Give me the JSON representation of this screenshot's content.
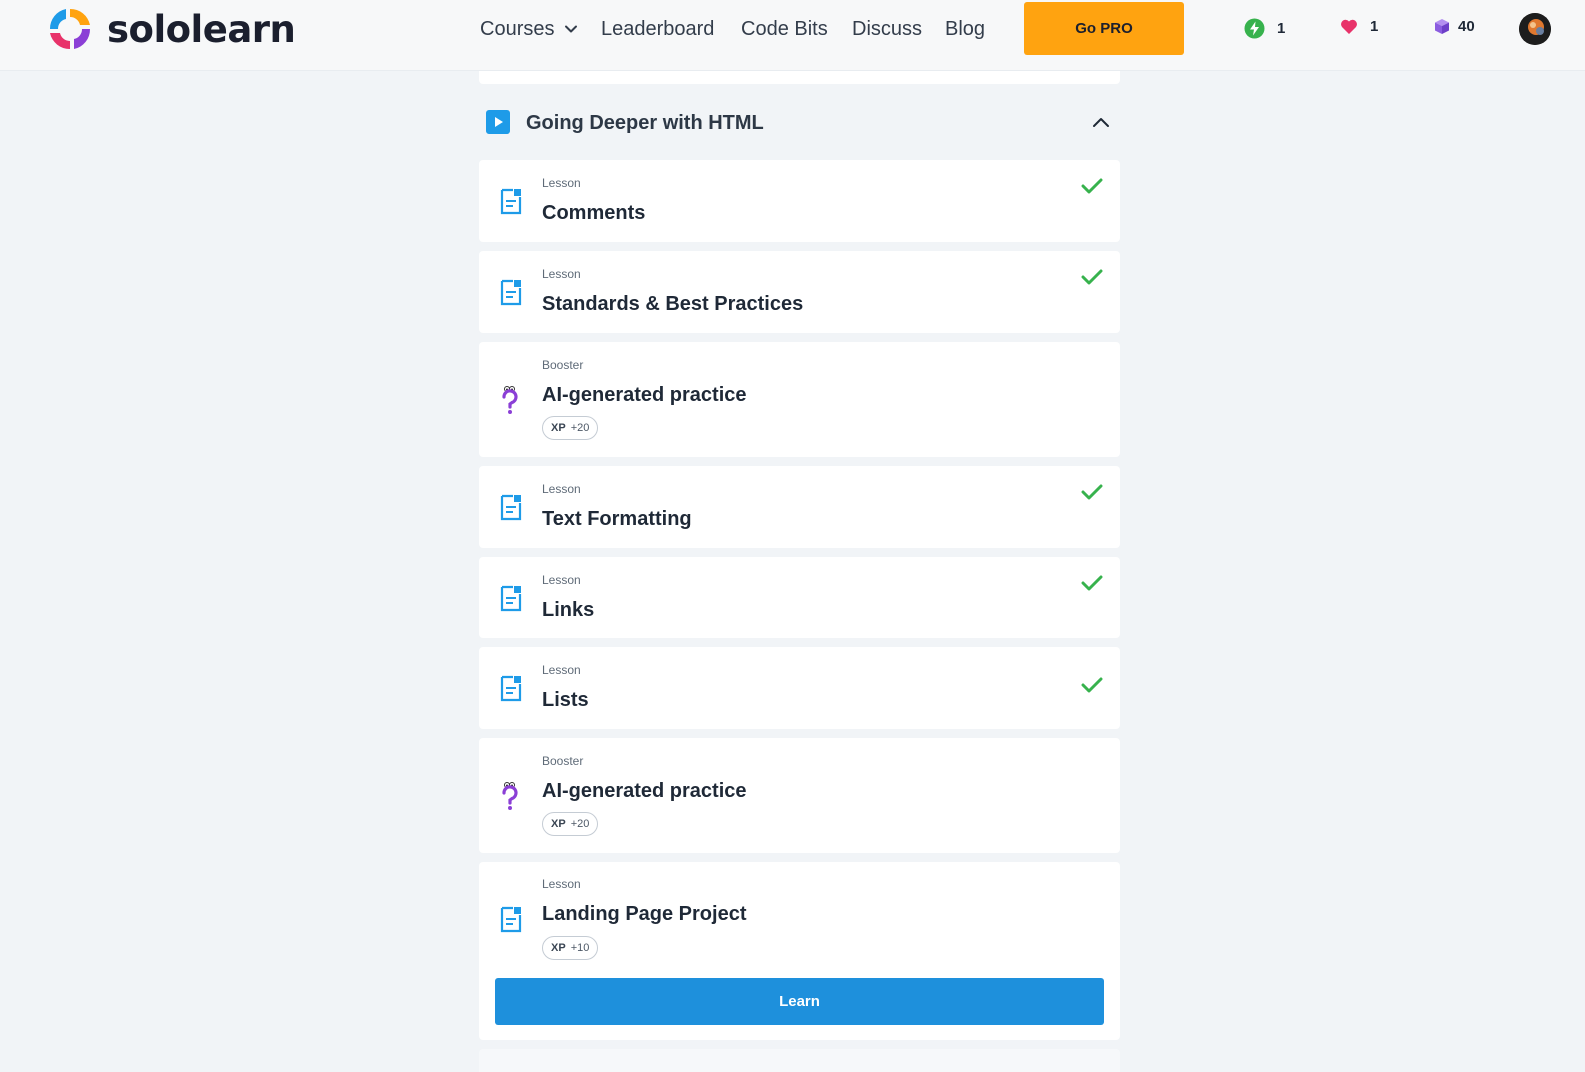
{
  "header": {
    "logo_text": "sololearn",
    "nav": {
      "courses": "Courses",
      "leaderboard": "Leaderboard",
      "code_bits": "Code Bits",
      "discuss": "Discuss",
      "blog": "Blog"
    },
    "go_pro": "Go PRO",
    "stats": {
      "streak": "1",
      "hearts": "1",
      "gems": "40"
    }
  },
  "colors": {
    "accent_blue": "#1e90dc",
    "pro_orange": "#ffa310",
    "check_green": "#37b24d",
    "booster_purple": "#8b3fd6"
  },
  "section": {
    "title": "Going Deeper with HTML",
    "expanded": true
  },
  "items": [
    {
      "kind": "Lesson",
      "title": "Comments",
      "completed": true,
      "icon": "lesson-icon"
    },
    {
      "kind": "Lesson",
      "title": "Standards & Best Practices",
      "completed": true,
      "icon": "lesson-icon"
    },
    {
      "kind": "Booster",
      "title": "AI-generated practice",
      "xp_label": "XP",
      "xp_value": "+20",
      "icon": "question-mark-icon"
    },
    {
      "kind": "Lesson",
      "title": "Text Formatting",
      "completed": true,
      "icon": "lesson-icon"
    },
    {
      "kind": "Lesson",
      "title": "Links",
      "completed": true,
      "icon": "lesson-icon"
    },
    {
      "kind": "Lesson",
      "title": "Lists",
      "completed": true,
      "icon": "lesson-icon"
    },
    {
      "kind": "Booster",
      "title": "AI-generated practice",
      "xp_label": "XP",
      "xp_value": "+20",
      "icon": "question-mark-icon"
    },
    {
      "kind": "Lesson",
      "title": "Landing Page Project",
      "xp_label": "XP",
      "xp_value": "+10",
      "icon": "lesson-icon",
      "action": "Learn"
    }
  ]
}
